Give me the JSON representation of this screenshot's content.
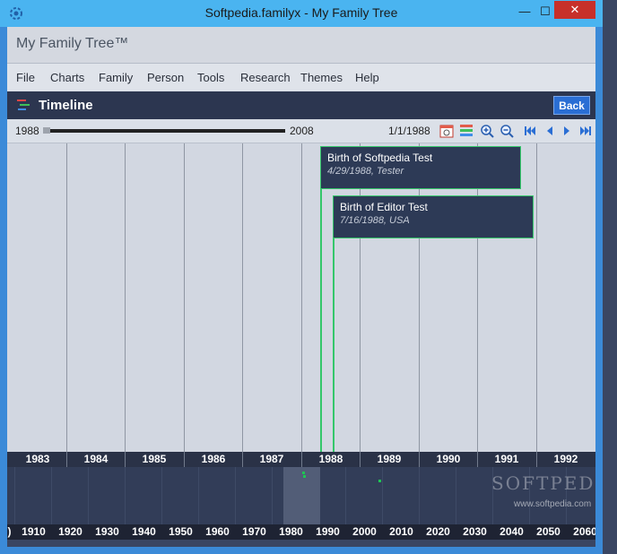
{
  "window": {
    "title": "Softpedia.familyx - My Family Tree",
    "minimize": "—",
    "maximize": "☐",
    "close": "✕"
  },
  "app": {
    "title": "My Family Tree™"
  },
  "menu": [
    "File",
    "Charts",
    "Family",
    "Person",
    "Tools",
    "Research",
    "Themes",
    "Help"
  ],
  "header": {
    "title": "Timeline",
    "back_label": "Back",
    "icon": "timeline-icon"
  },
  "toolbar": {
    "range_start": "1988",
    "range_end": "2008",
    "current_date": "1/1/1988",
    "buttons": [
      "calendar-icon",
      "layers-icon",
      "zoom-in-icon",
      "zoom-out-icon",
      "first-icon",
      "previous-icon",
      "next-icon",
      "last-icon"
    ]
  },
  "events": [
    {
      "title": "Birth of Softpedia Test",
      "detail": "4/29/1988, Tester"
    },
    {
      "title": "Birth of Editor Test",
      "detail": "7/16/1988, USA"
    }
  ],
  "years": [
    "1983",
    "1984",
    "1985",
    "1986",
    "1987",
    "1988",
    "1989",
    "1990",
    "1991",
    "1992"
  ],
  "decades": [
    ")",
    "1910",
    "1920",
    "1930",
    "1940",
    "1950",
    "1960",
    "1970",
    "1980",
    "1990",
    "2000",
    "2010",
    "2020",
    "2030",
    "2040",
    "2050",
    "2060"
  ],
  "watermark": {
    "brand": "SOFTPEDIA",
    "url": "www.softpedia.com"
  },
  "colors": {
    "accent": "#2a6ed4",
    "event_border": "#34c76a",
    "titlebar": "#4ab4f0"
  }
}
